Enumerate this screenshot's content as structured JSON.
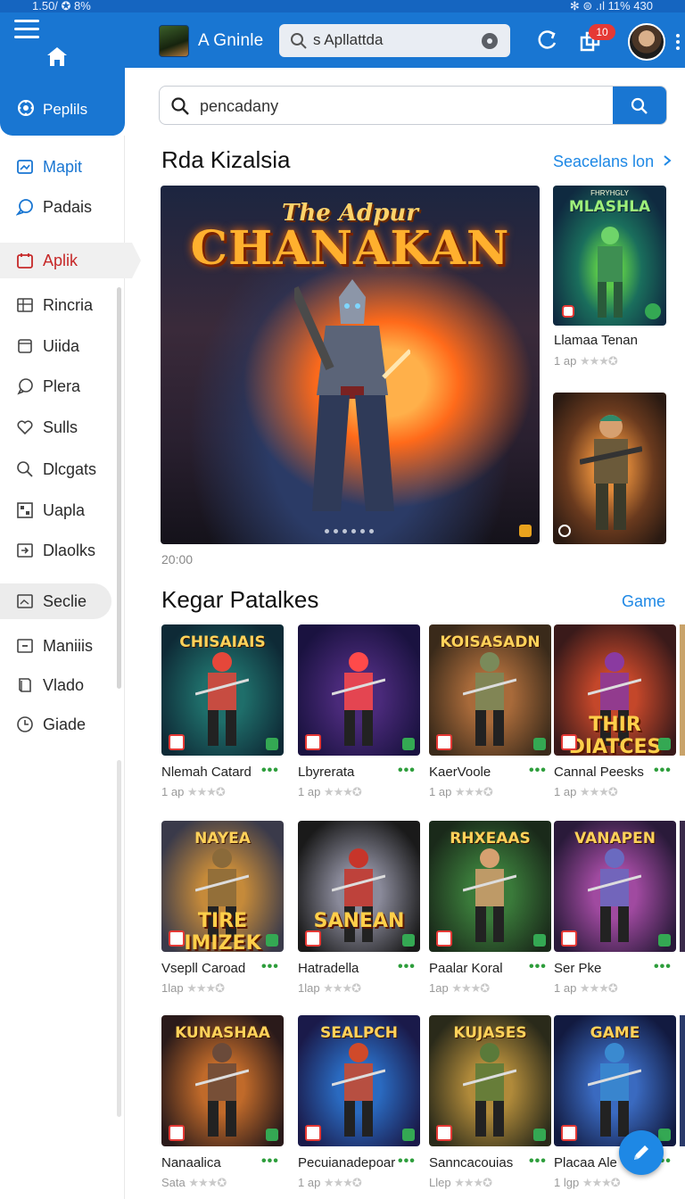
{
  "status_bar": {
    "left": "1.50/ ✪ 8%",
    "right": "✻ ⊜ .ıl 11% 430"
  },
  "header": {
    "app_title": "A Gninle",
    "search_value": "s Apllattda",
    "notification_count": "10"
  },
  "sidebar": {
    "tab_label": "Peplils",
    "items": [
      {
        "label": "Mapit",
        "icon": "image-icon"
      },
      {
        "label": "Padais",
        "icon": "chat-icon"
      },
      {
        "label": "Aplik",
        "icon": "calendar-icon"
      },
      {
        "label": "Rincria",
        "icon": "grid-icon"
      },
      {
        "label": "Uiida",
        "icon": "window-icon"
      },
      {
        "label": "Plera",
        "icon": "message-icon"
      },
      {
        "label": "Sulls",
        "icon": "heart-icon"
      },
      {
        "label": "Dlcgats",
        "icon": "search-icon"
      },
      {
        "label": "Uapla",
        "icon": "mosaic-icon"
      },
      {
        "label": "Dlaolks",
        "icon": "download-icon"
      },
      {
        "label": "Seclie",
        "icon": "photo-icon"
      },
      {
        "label": "Maniiis",
        "icon": "minus-box-icon"
      },
      {
        "label": "Vlado",
        "icon": "book-icon"
      },
      {
        "label": "Giade",
        "icon": "clock-icon"
      }
    ]
  },
  "main_search": {
    "value": "pencadany"
  },
  "featured_section": {
    "title": "Rda Kizalsia",
    "link": "Seacelans lon",
    "hero_title_top": "The Adpur",
    "hero_title_main": "CHANAKAN",
    "caption": "20:00",
    "side_cards": [
      {
        "art_title": "MLASHLA",
        "art_sub": "FHRYHGLY",
        "name": "Llamaa Tenan",
        "meta": "1 ap"
      },
      {
        "art_title": "",
        "art_sub": "",
        "name": "",
        "meta": ""
      }
    ]
  },
  "games_section": {
    "title": "Kegar Patalkes",
    "link": "Game",
    "rows": [
      [
        {
          "art": "CHISAIAIS",
          "art2": "",
          "name": "Nlemah Catard",
          "meta": "1 ap"
        },
        {
          "art": "",
          "art2": "",
          "name": "Lbyrerata",
          "meta": "1 ap"
        },
        {
          "art": "KOISASADN",
          "art2": "",
          "name": "KaerVoole",
          "meta": "1 ap"
        },
        {
          "art": "",
          "art2": "THIR DIATCES",
          "name": "Cannal Peesks",
          "meta": "1 ap"
        }
      ],
      [
        {
          "art": "NAYEA",
          "art2": "TIRE IMIZEK",
          "name": "Vsepll Caroad",
          "meta": "1lap"
        },
        {
          "art": "",
          "art2": "SANEAN",
          "name": "Hatradella",
          "meta": "1lap"
        },
        {
          "art": "RHXEAAS",
          "art2": "",
          "name": "Paalar Koral",
          "meta": "1ap"
        },
        {
          "art": "VANAPEN",
          "art2": "",
          "name": "Ser Pke",
          "meta": "1 ap"
        }
      ],
      [
        {
          "art": "KUNASHAA",
          "art2": "",
          "name": "Nanaalica",
          "meta": "Sata"
        },
        {
          "art": "SEALPCH",
          "art2": "",
          "name": "Pecuianadepoar",
          "meta": "1 ap"
        },
        {
          "art": "KUJASES",
          "art2": "",
          "name": "Sanncacouias",
          "meta": "Llep"
        },
        {
          "art": "GAME",
          "art2": "",
          "name": "Placaa Ale",
          "meta": "1 lgp"
        }
      ]
    ]
  },
  "colors": {
    "primary": "#1976d2",
    "accent_link": "#1e88e5",
    "active_nav": "#c62828",
    "dots_green": "#2e9e3c"
  }
}
